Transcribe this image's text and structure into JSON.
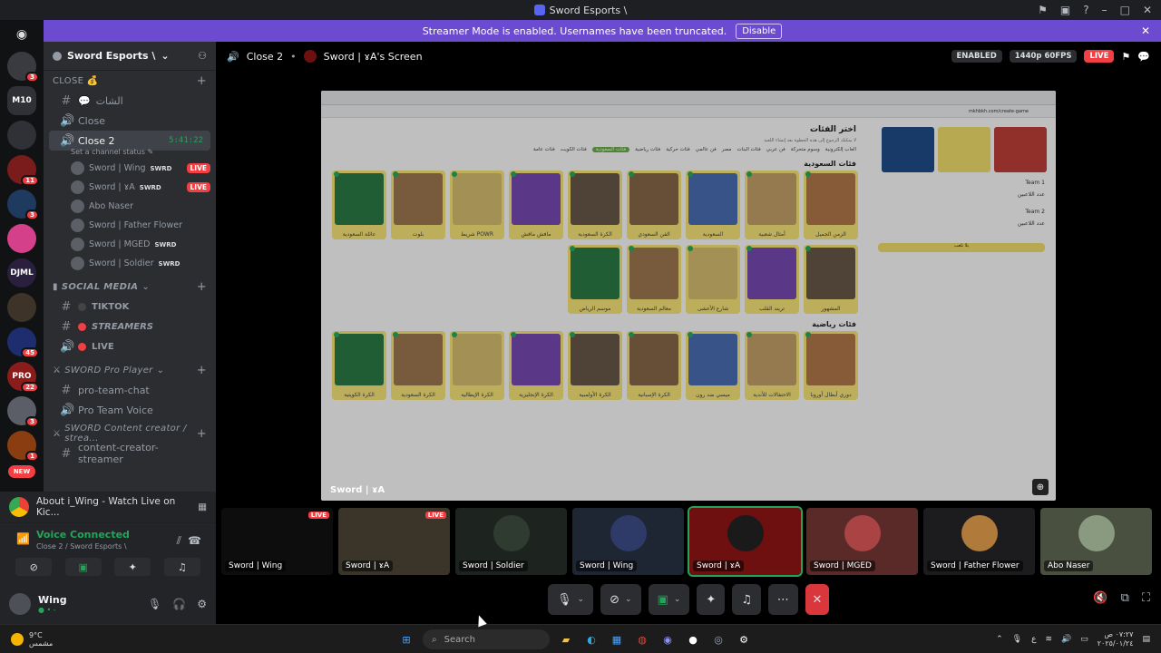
{
  "window": {
    "title": "Sword Esports \\"
  },
  "banner": {
    "text": "Streamer Mode is enabled. Usernames have been truncated.",
    "disable": "Disable"
  },
  "guilds": [
    {
      "label": "",
      "color": "#3a3b40",
      "badge": "3"
    },
    {
      "label": "M10",
      "color": "#2f3136",
      "badge": ""
    },
    {
      "label": "",
      "color": "#2f3136",
      "badge": ""
    },
    {
      "label": "",
      "color": "#7a1c1c",
      "badge": "11"
    },
    {
      "label": "",
      "color": "#1e3a5f",
      "badge": "3"
    },
    {
      "label": "",
      "color": "#d4408a",
      "badge": ""
    },
    {
      "label": "DJML",
      "color": "#2a1f3d",
      "badge": ""
    },
    {
      "label": "",
      "color": "#3d3328",
      "badge": ""
    },
    {
      "label": "",
      "color": "#1d2d6e",
      "badge": "45"
    },
    {
      "label": "PRO",
      "color": "#8a1c1c",
      "badge": "22"
    },
    {
      "label": "",
      "color": "#5b5e66",
      "badge": "3"
    },
    {
      "label": "",
      "color": "#8a3d10",
      "badge": "1"
    }
  ],
  "guild_new": "NEW",
  "server": {
    "name": "Sword Esports \\"
  },
  "channels": {
    "cat_close": "CLOSE 💰",
    "chat": "الشات",
    "close": "Close",
    "close2": "Close 2",
    "close2_time": "5:41:22",
    "close2_status": "Set a channel status",
    "voice_users": [
      {
        "name": "Sword | Wing",
        "tag": "SWRD",
        "live": "LIVE"
      },
      {
        "name": "Sword | ɤA",
        "tag": "SWRD",
        "live": "LIVE"
      },
      {
        "name": "Abo Naser",
        "tag": "",
        "live": ""
      },
      {
        "name": "Sword | Father Flower",
        "tag": "",
        "live": ""
      },
      {
        "name": "Sword | MGED",
        "tag": "SWRD",
        "live": ""
      },
      {
        "name": "Sword | Soldier",
        "tag": "SWRD",
        "live": ""
      }
    ],
    "cat_social": "SOCIAL MEDIA",
    "tiktok": "TIKTOK",
    "streamers": "STREAMERS",
    "live": "LIVE",
    "cat_pro": "SWORD Pro Player",
    "pro_chat": "pro-team-chat",
    "pro_voice": "Pro Team Voice",
    "cat_creator": "SWORD Content creator / strea...",
    "creator_chan": "content-creator-streamer"
  },
  "activity": {
    "text": "About i_Wing - Watch Live on Kic..."
  },
  "voice": {
    "connected": "Voice Connected",
    "sub": "Close 2 / Sword Esports \\"
  },
  "user": {
    "name": "Wing",
    "status": "● • -"
  },
  "call": {
    "channel": "Close 2",
    "screen_owner": "Sword | ɤA's Screen",
    "enabled": "ENABLED",
    "quality": "1440p 60FPS",
    "live": "LIVE"
  },
  "shared": {
    "heading": "اختر الفئات",
    "sub": "لا يمكنك الرجوع إلى هذه الخطوة بعد إنشاء اللعبة",
    "url": "mkhbkh.com/create-game",
    "filters": [
      "فئات عامة",
      "فئات الكويت",
      "فئات السعودية",
      "فئات رياضية",
      "فئات حركية",
      "فن عالمي",
      "مصر",
      "فئات البنات",
      "فن عربي",
      "وسوم متحركة",
      "العاب إلكترونية"
    ],
    "section1": "فئات السعودية",
    "row1": [
      "عائلة السعودية",
      "بلوت",
      "شريط POWR",
      "مافش مافش",
      "الكرة السعودية",
      "الفن السعودي",
      "السعودية",
      "أمثال شعبية",
      "الزمن الجميل"
    ],
    "row2": [
      "موسم الرياض",
      "معالم السعودية",
      "شارع الأعشى",
      "تريند القلب",
      "المشهور"
    ],
    "section2": "فئات رياضية",
    "row3": [
      "الكرة الكويتية",
      "الكرة السعودية",
      "الكرة الإيطالية",
      "الكرة الإنجليزية",
      "الكرة الأولمبية",
      "الكرة الإسبانية",
      "ميسي ضد رون",
      "الاحتفالات للأندية",
      "دوري أبطال أوروبا"
    ],
    "side_team1": "Team 1",
    "side_team2": "Team 2",
    "side_players": "عدد اللاعبين",
    "side_btn": "يلا نلعب",
    "watermark": "Sword | ɤA"
  },
  "tiles": [
    {
      "name": "Sword | Wing",
      "live": "LIVE",
      "bg": "#0d0d0d",
      "av": ""
    },
    {
      "name": "Sword | ɤA",
      "live": "LIVE",
      "bg": "#3a3528",
      "av": ""
    },
    {
      "name": "Sword | Soldier",
      "live": "",
      "bg": "#1d2420",
      "av": "#2f3b30"
    },
    {
      "name": "Sword | Wing",
      "live": "",
      "bg": "#1f2633",
      "av": "#2e3a68"
    },
    {
      "name": "Sword | ɤA",
      "live": "",
      "bg": "#6e1010",
      "av": "#1a1a1a"
    },
    {
      "name": "Sword | MGED",
      "live": "",
      "bg": "#5a2a28",
      "av": "#a44"
    },
    {
      "name": "Sword | Father Flower",
      "live": "",
      "bg": "#1c1c1e",
      "av": "#b07a3a"
    },
    {
      "name": "Abo Naser",
      "live": "",
      "bg": "#4a5040",
      "av": "#8a9a80"
    }
  ],
  "taskbar": {
    "weather_temp": "9°C",
    "weather_desc": "مشمس",
    "search": "Search",
    "time": "٠٧:٢٧ ص",
    "date": "٢٠٢٥/٠١/٢٤"
  },
  "colors": {
    "accent": "#5865f2",
    "live": "#f23f43",
    "online": "#23a559"
  }
}
